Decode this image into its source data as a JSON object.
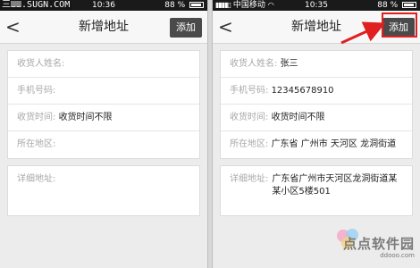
{
  "left": {
    "status": {
      "carrier_partial": "",
      "time": "10:36",
      "battery": "88 %"
    },
    "nav": {
      "back": "<",
      "title": "新增地址",
      "add": "添加"
    },
    "form": {
      "name_label": "收货人姓名:",
      "phone_label": "手机号码:",
      "time_label": "收货时间:",
      "time_value": "收货时间不限",
      "region_label": "所在地区:",
      "detail_label": "详细地址:"
    }
  },
  "right": {
    "status": {
      "carrier": "中国移动",
      "time": "10:35",
      "battery": "88 %"
    },
    "nav": {
      "back": "<",
      "title": "新增地址",
      "add": "添加"
    },
    "form": {
      "name_label": "收货人姓名:",
      "name_value": "张三",
      "phone_label": "手机号码:",
      "phone_value": "12345678910",
      "time_label": "收货时间:",
      "time_value": "收货时间不限",
      "region_label": "所在地区:",
      "region_value": "广东省 广州市 天河区 龙洞街道",
      "detail_label": "详细地址:",
      "detail_value": "广东省广州市天河区龙洞街道某某小区5楼501"
    }
  },
  "watermarks": {
    "top_left": "三ШШ.SUGN.COM",
    "bottom_right_main": "点点软件园",
    "bottom_right_sub": "ddooo.com"
  },
  "colors": {
    "highlight": "#e02020",
    "add_button_bg": "#4a4a4a",
    "label_gray": "#a8a8a8"
  }
}
